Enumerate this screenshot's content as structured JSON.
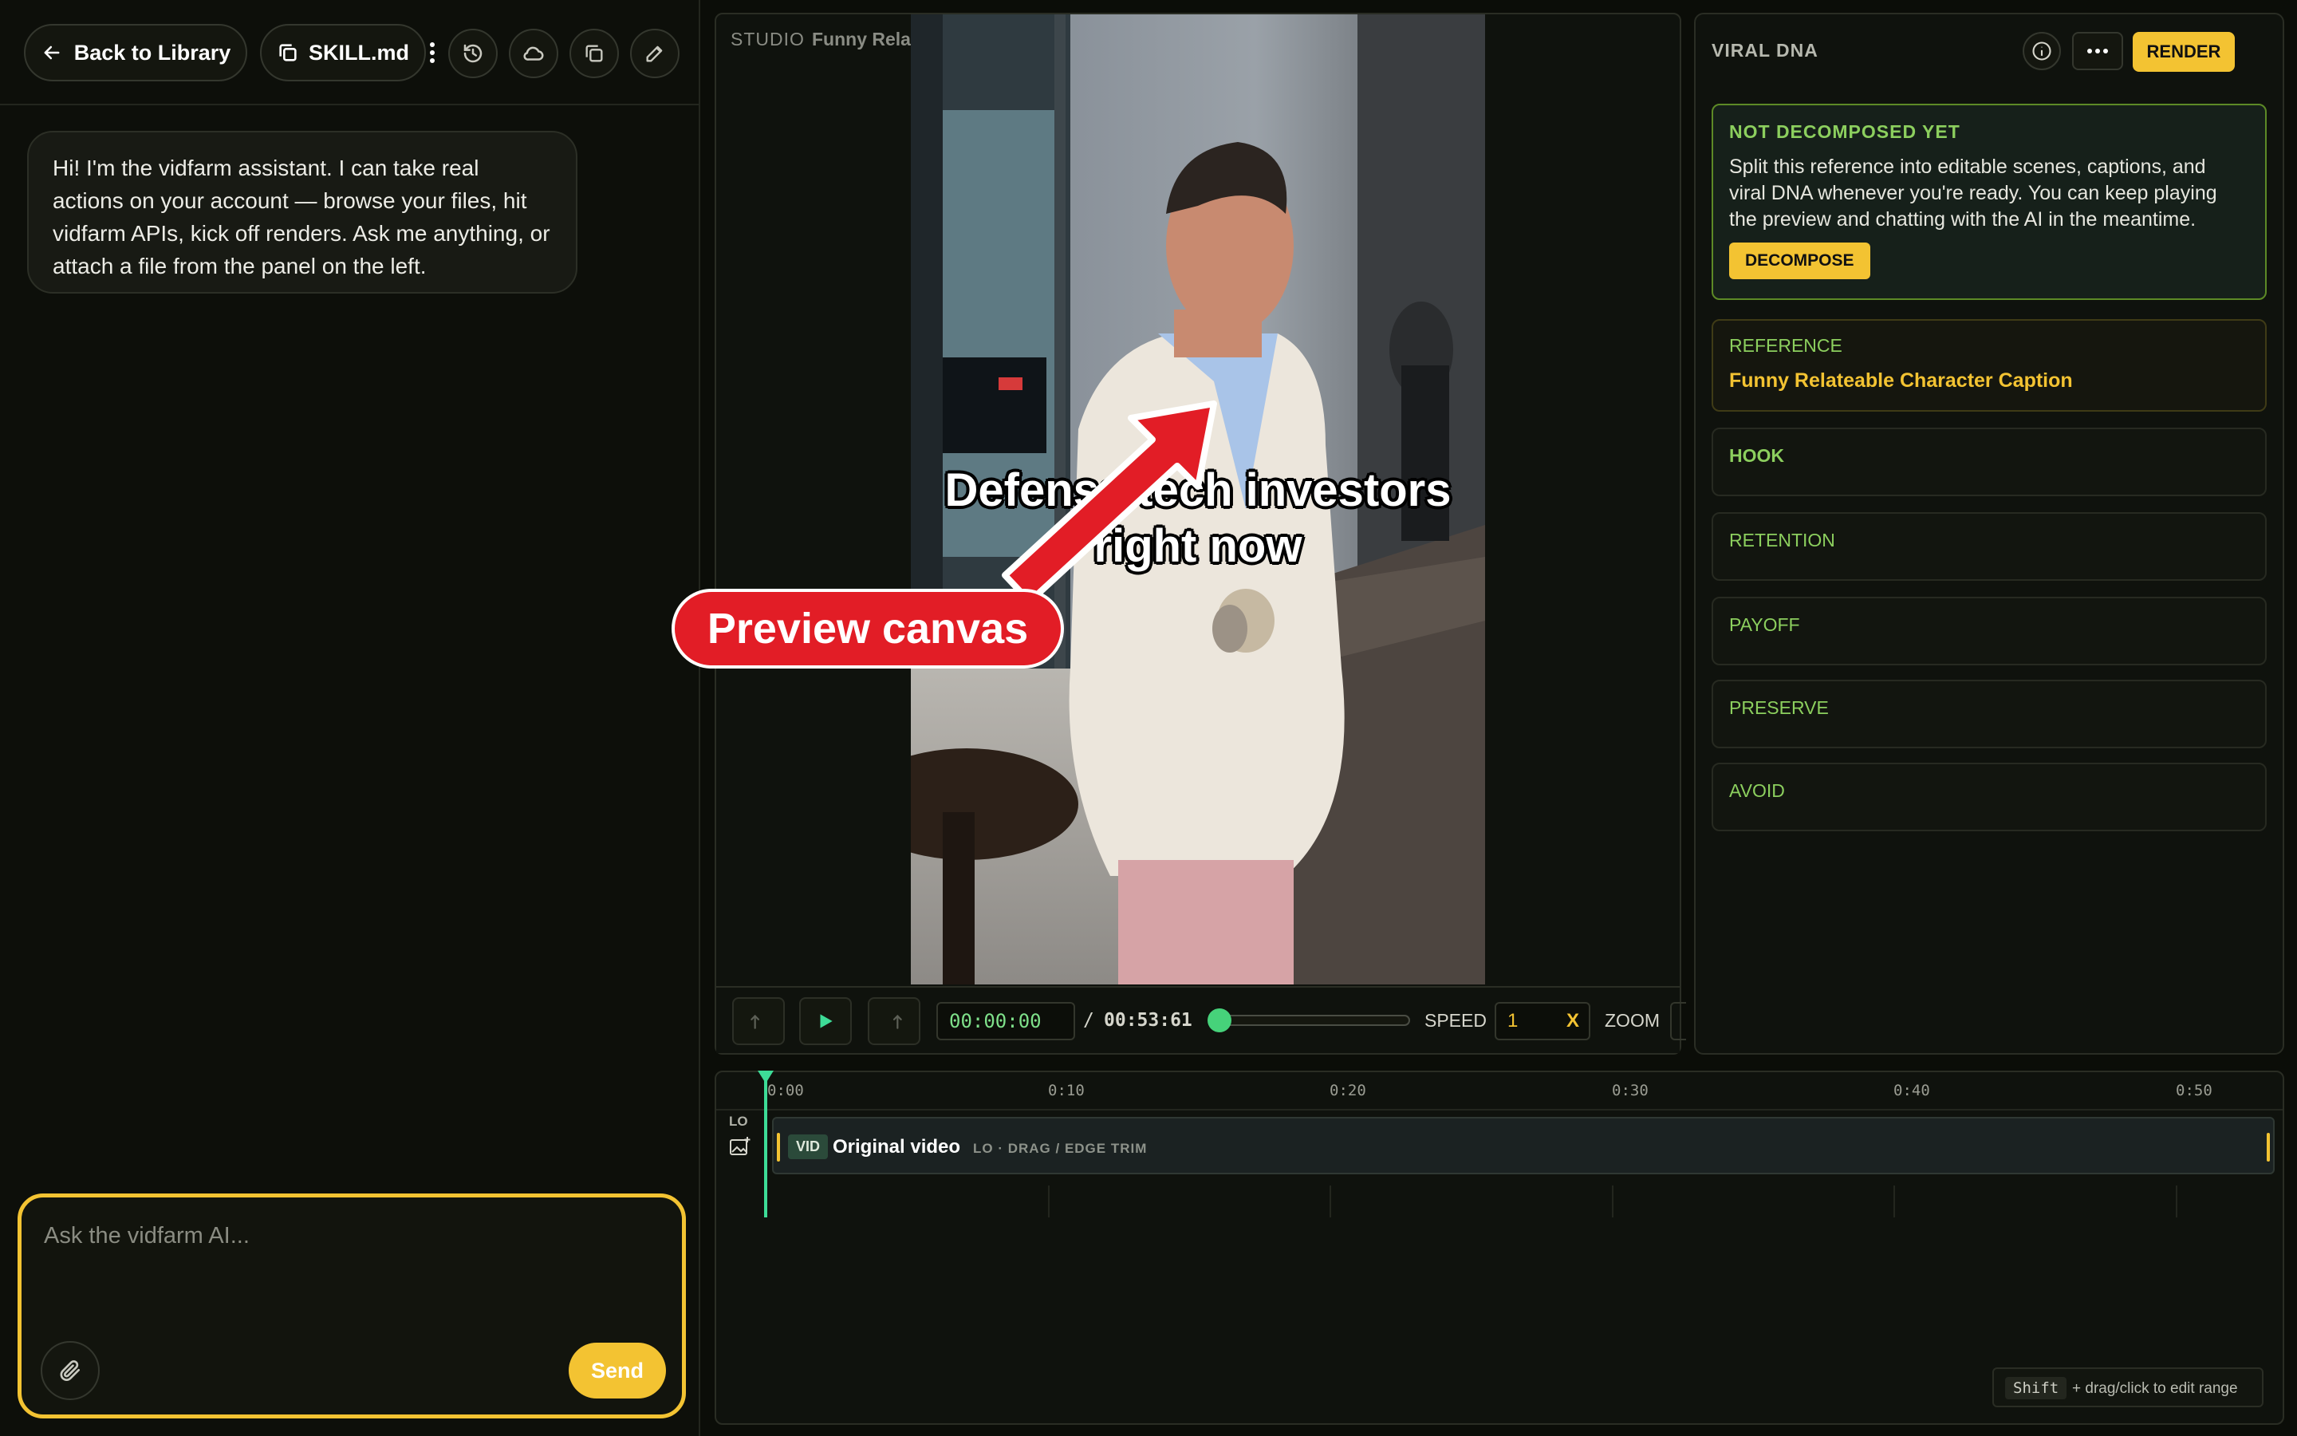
{
  "chat": {
    "back_label": "Back to Library",
    "file_label": "SKILL.md",
    "assistant_message": "Hi! I'm the vidfarm assistant. I can take real actions on your account — browse your files, hit vidfarm APIs, kick off renders. Ask me anything, or attach a file from the panel on the left.",
    "input_placeholder": "Ask the vidfarm AI...",
    "send_label": "Send"
  },
  "preview": {
    "studio_label": "STUDIO",
    "title": "Funny Relateable Character Caption",
    "caption_line1": "Defense tech investors",
    "caption_line2": "right now",
    "callout_label": "Preview canvas"
  },
  "controls": {
    "current_time": "00:00:00",
    "separator": "/",
    "total_time": "00:53:61",
    "speed_label": "SPEED",
    "speed_value": "1",
    "speed_unit": "X",
    "zoom_label": "ZOOM",
    "scrub_progress": 0.0
  },
  "viral": {
    "title": "VIRAL DNA",
    "render_label": "RENDER",
    "status_heading": "NOT DECOMPOSED YET",
    "status_text": "Split this reference into editable scenes, captions, and viral DNA whenever you're ready. You can keep playing the preview and chatting with the AI in the meantime.",
    "decompose_label": "DECOMPOSE",
    "reference_label": "REFERENCE",
    "reference_value": "Funny Relateable Character Caption",
    "sections": [
      "HOOK",
      "RETENTION",
      "PAYOFF",
      "PRESERVE",
      "AVOID"
    ]
  },
  "timeline": {
    "ticks": [
      "0:00",
      "0:10",
      "0:20",
      "0:30",
      "0:40",
      "0:50"
    ],
    "lane_label": "LO",
    "clip_badge": "VID",
    "clip_title": "Original video",
    "clip_meta": "LO · DRAG / EDGE TRIM",
    "hint_key": "Shift",
    "hint_text": "+ drag/click to edit range"
  },
  "colors": {
    "accent": "#f3c332",
    "green": "#8ccf5e",
    "playhead": "#3ddc97",
    "callout": "#e21d26"
  }
}
